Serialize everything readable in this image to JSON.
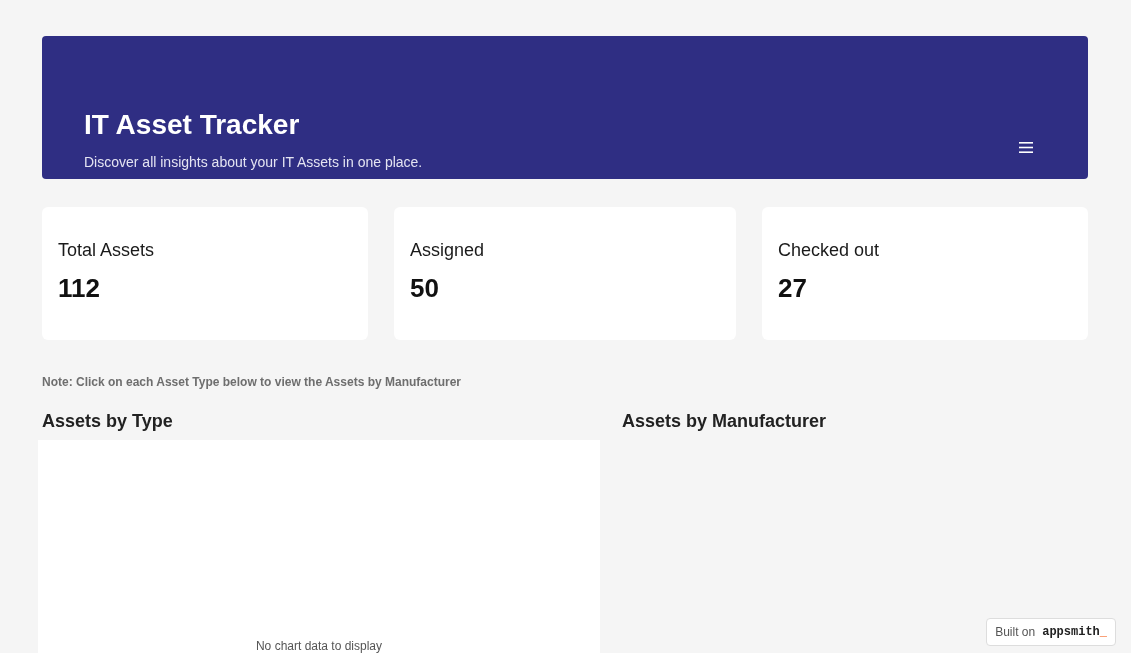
{
  "header": {
    "title": "IT Asset Tracker",
    "subtitle": "Discover all insights about your IT Assets in one place."
  },
  "stats": [
    {
      "label": "Total Assets",
      "value": "112"
    },
    {
      "label": "Assigned",
      "value": "50"
    },
    {
      "label": "Checked out",
      "value": "27"
    }
  ],
  "note": "Note: Click on each Asset Type below to view the Assets by Manufacturer",
  "charts": [
    {
      "title": "Assets by Type",
      "message": "No chart data to display"
    },
    {
      "title": "Assets by Manufacturer"
    }
  ],
  "badge": {
    "prefix": "Built on",
    "brand": "appsmith",
    "brand_suffix": "_"
  }
}
